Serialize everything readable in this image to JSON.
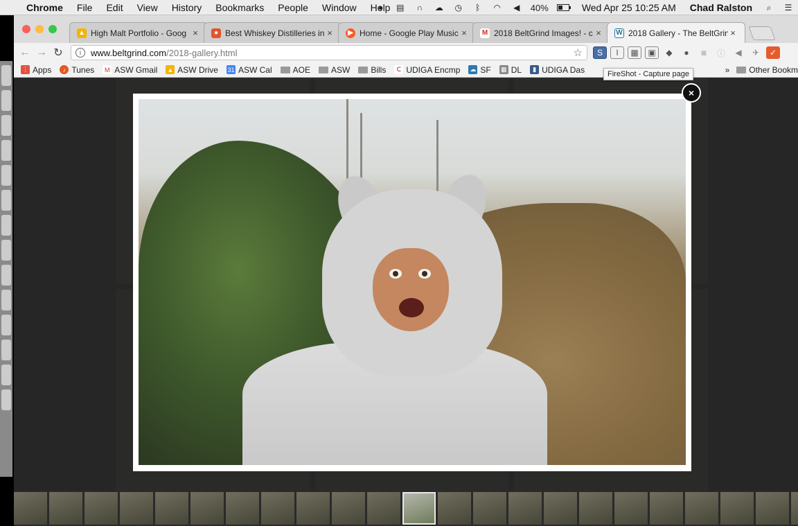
{
  "menubar": {
    "app": "Chrome",
    "items": [
      "File",
      "Edit",
      "View",
      "History",
      "Bookmarks",
      "People",
      "Window",
      "Help"
    ],
    "battery": "40%",
    "datetime": "Wed Apr 25  10:25 AM",
    "user": "Chad Ralston"
  },
  "tabs": [
    {
      "title": "High Malt Portfolio - Goog",
      "favicon_color": "#f4b400",
      "active": false
    },
    {
      "title": "Best Whiskey Distilleries in",
      "favicon_color": "#e0552f",
      "active": false
    },
    {
      "title": "Home - Google Play Music",
      "favicon_color": "#ff5722",
      "active": false
    },
    {
      "title": "2018 BeltGrind Images! - c",
      "favicon_color": "#d93025",
      "active": false
    },
    {
      "title": "2018 Gallery - The BeltGrin",
      "favicon_color": "#21759b",
      "active": true
    }
  ],
  "address": {
    "host": "www.beltgrind.com",
    "path": "/2018-gallery.html"
  },
  "bookmarks": {
    "items": [
      {
        "label": "Apps",
        "icon": "apps-grid-icon",
        "color": "#d33"
      },
      {
        "label": "Tunes",
        "icon": "music-icon",
        "color": "#e65722"
      },
      {
        "label": "ASW Gmail",
        "icon": "gmail-icon",
        "color": "#d93025"
      },
      {
        "label": "ASW Drive",
        "icon": "drive-icon",
        "color": "#f4b400"
      },
      {
        "label": "ASW Cal",
        "icon": "calendar-icon",
        "color": "#4285f4"
      },
      {
        "label": "AOE",
        "icon": "folder-icon",
        "color": "#999"
      },
      {
        "label": "ASW",
        "icon": "folder-icon",
        "color": "#999"
      },
      {
        "label": "Bills",
        "icon": "folder-icon",
        "color": "#999"
      },
      {
        "label": "UDIGA Encmp",
        "icon": "udiga-icon",
        "color": "#b33"
      },
      {
        "label": "SF",
        "icon": "salesforce-icon",
        "color": "#2a7ab0"
      },
      {
        "label": "DL",
        "icon": "dl-icon",
        "color": "#555"
      },
      {
        "label": "UDIGA Das",
        "icon": "udiga-dash-icon",
        "color": "#3a5a8a"
      }
    ],
    "overflow": "»",
    "other": "Other Bookm"
  },
  "tooltip": "FireShot - Capture page",
  "lightbox": {
    "close_label": "×",
    "thumb_count": 25,
    "selected_thumb": 11
  }
}
